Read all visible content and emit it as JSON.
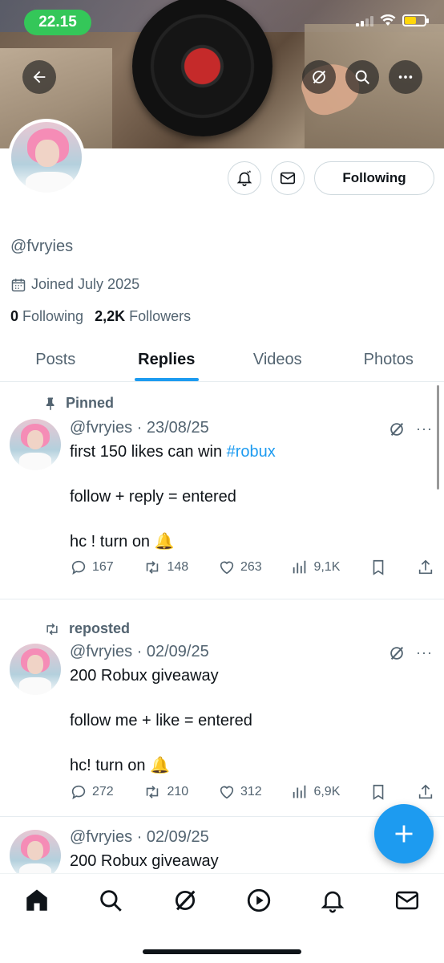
{
  "status_bar": {
    "time": "22.15"
  },
  "profile": {
    "handle": "@fvryies",
    "joined": "Joined July 2025",
    "following_count": "0",
    "following_label": "Following",
    "followers_count": "2,2K",
    "followers_label": "Followers",
    "follow_button": "Following"
  },
  "tabs": [
    {
      "label": "Posts"
    },
    {
      "label": "Replies",
      "active": true
    },
    {
      "label": "Videos"
    },
    {
      "label": "Photos"
    }
  ],
  "posts": [
    {
      "context": "Pinned",
      "handle": "@fvryies",
      "date": "23/08/25",
      "line1_text": "first 150 likes can win ",
      "line1_hashtag": "#robux",
      "line2": "follow + reply = entered",
      "line3": "hc ! turn on 🔔",
      "replies": "167",
      "reposts": "148",
      "likes": "263",
      "views": "9,1K"
    },
    {
      "context": "reposted",
      "handle": "@fvryies",
      "date": "02/09/25",
      "line1": "200 Robux giveaway",
      "line2": "follow me + like = entered",
      "line3": "hc! turn on 🔔",
      "replies": "272",
      "reposts": "210",
      "likes": "312",
      "views": "6,9K"
    },
    {
      "handle": "@fvryies",
      "date": "02/09/25",
      "line1": "200 Robux giveaway"
    }
  ],
  "colors": {
    "accent": "#1d9bf0",
    "status_green": "#34c759"
  },
  "icons": [
    "back-arrow-icon",
    "grok-icon",
    "search-icon",
    "more-icon",
    "notification-bell-icon",
    "mail-icon",
    "calendar-icon",
    "pin-icon",
    "repost-icon",
    "reply-icon",
    "like-icon",
    "views-icon",
    "bookmark-icon",
    "share-icon",
    "plus-icon",
    "home-icon",
    "play-icon",
    "messages-icon"
  ]
}
